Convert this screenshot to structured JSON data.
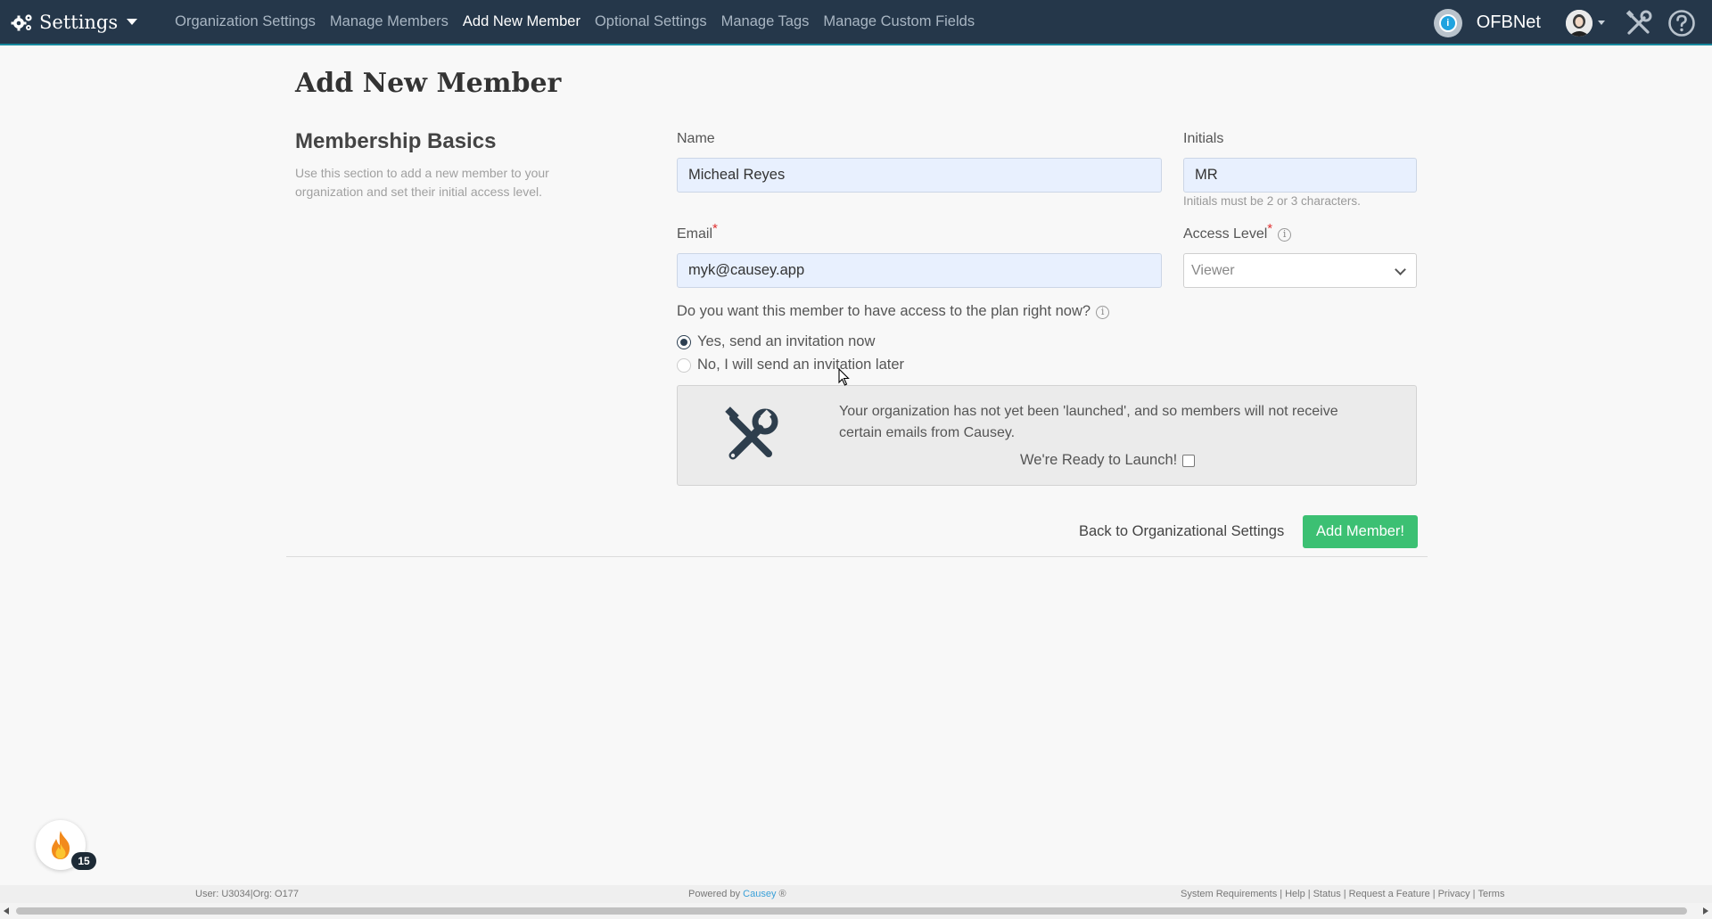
{
  "nav": {
    "brand_label": "Settings",
    "links": [
      {
        "label": "Organization Settings",
        "active": false
      },
      {
        "label": "Manage Members",
        "active": false
      },
      {
        "label": "Add New Member",
        "active": true
      },
      {
        "label": "Optional Settings",
        "active": false
      },
      {
        "label": "Manage Tags",
        "active": false
      },
      {
        "label": "Manage Custom Fields",
        "active": false
      }
    ],
    "org_name": "OFBNet",
    "org_badge_icon": "organization-badge-icon",
    "accent_color": "#25374a"
  },
  "page": {
    "title": "Add New Member",
    "section_title": "Membership Basics",
    "section_description": "Use this section to add a new member to your organization and set their initial access level."
  },
  "form": {
    "name_label": "Name",
    "name_value": "Micheal Reyes",
    "initials_label": "Initials",
    "initials_value": "MR",
    "initials_help": "Initials must be 2 or 3 characters.",
    "email_label": "Email",
    "email_value": "myk@causey.app",
    "required_mark": "*",
    "access_label": "Access Level",
    "access_value": "Viewer",
    "info_glyph": "i",
    "question": "Do you want this member to have access to the plan right now?",
    "option_yes": "Yes, send an invitation now",
    "option_no": "No, I will send an invitation later",
    "selected_option": "yes"
  },
  "notice": {
    "message": "Your organization has not yet been 'launched', and so members will not receive certain emails from Causey.",
    "launch_label": "We're Ready to Launch!",
    "launch_checked": false,
    "icon": "tools-icon"
  },
  "actions": {
    "back_label": "Back to Organizational Settings",
    "add_label": "Add Member!",
    "add_color": "#3cc073"
  },
  "streak": {
    "icon": "flame-icon",
    "count": "15"
  },
  "footer": {
    "user_info": "User: U3034|Org: O177",
    "powered_prefix": "Powered by",
    "powered_brand": "Causey",
    "powered_suffix": "®",
    "links": [
      "System Requirements",
      "Help",
      "Status",
      "Request a Feature",
      "Privacy",
      "Terms"
    ],
    "link_separator": "|"
  }
}
